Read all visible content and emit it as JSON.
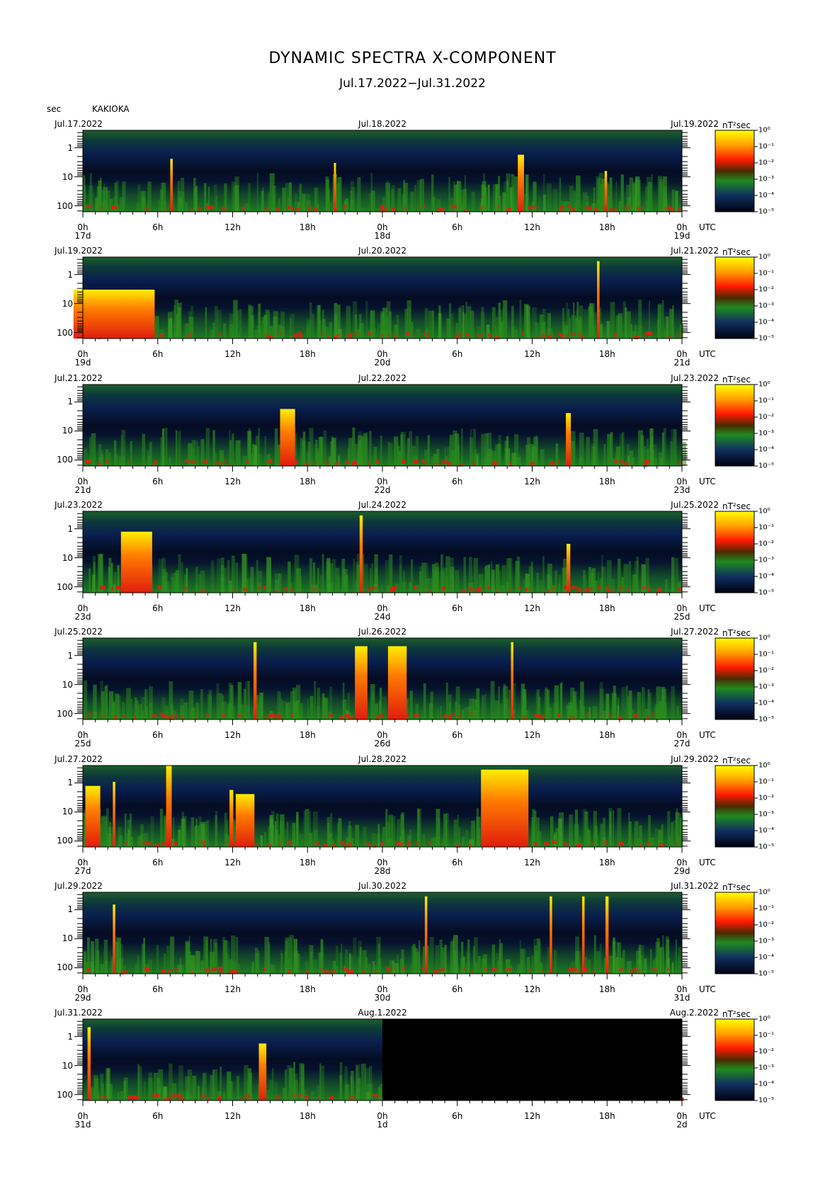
{
  "title": "DYNAMIC SPECTRA X-COMPONENT",
  "subtitle": "Jul.17.2022−Jul.31.2022",
  "y_unit_label": "sec",
  "station": "KAKIOKA",
  "utc_label": "UTC",
  "colorbar_unit": "nT²sec",
  "colors": {
    "background_dark": "#020a1c",
    "navy": "#0b1d52",
    "green": "#1f7a2a",
    "red": "#e01d0e",
    "orange": "#ff7b00",
    "yellow": "#ffee00",
    "no_data": "#000000"
  },
  "chart_data": {
    "type": "heatmap",
    "title": "DYNAMIC SPECTRA X-COMPONENT",
    "subtitle": "Jul.17.2022−Jul.31.2022",
    "ylabel": "sec",
    "y_scale": "log",
    "y_ticks": [
      "1",
      "10",
      "100"
    ],
    "x_ticks": [
      "0h",
      "6h",
      "12h",
      "18h",
      "0h",
      "6h",
      "12h",
      "18h",
      "0h"
    ],
    "colorbar": {
      "unit": "nT²sec",
      "scale": "log",
      "tick_labels": [
        "10⁰",
        "10⁻¹",
        "10⁻²",
        "10⁻³",
        "10⁻⁴",
        "10⁻⁵"
      ]
    },
    "panels": [
      {
        "left_date": "Jul.17.2022",
        "mid_date": "Jul.18.2022",
        "right_date": "Jul.19.2022",
        "day_labels": [
          "17d",
          "18d",
          "19d"
        ],
        "bursts": [
          {
            "t": 7.1,
            "w": 0.2,
            "level": 0.65
          },
          {
            "t": 20.2,
            "w": 0.15,
            "level": 0.6
          },
          {
            "t": 35.1,
            "w": 0.5,
            "level": 0.7
          },
          {
            "t": 41.9,
            "w": 0.2,
            "level": 0.5
          }
        ]
      },
      {
        "left_date": "Jul.19.2022",
        "mid_date": "Jul.20.2022",
        "right_date": "Jul.21.2022",
        "day_labels": [
          "19d",
          "20d",
          "21d"
        ],
        "bursts": [
          {
            "t": 41.3,
            "w": 0.2,
            "level": 0.95
          },
          {
            "t": 2.5,
            "w": 6.5,
            "level": 0.6
          }
        ]
      },
      {
        "left_date": "Jul.21.2022",
        "mid_date": "Jul.22.2022",
        "right_date": "Jul.23.2022",
        "day_labels": [
          "21d",
          "22d",
          "23d"
        ],
        "bursts": [
          {
            "t": 16.4,
            "w": 1.2,
            "level": 0.7
          },
          {
            "t": 38.9,
            "w": 0.4,
            "level": 0.65
          }
        ]
      },
      {
        "left_date": "Jul.23.2022",
        "mid_date": "Jul.24.2022",
        "right_date": "Jul.25.2022",
        "day_labels": [
          "23d",
          "24d",
          "25d"
        ],
        "bursts": [
          {
            "t": 22.3,
            "w": 0.25,
            "level": 0.95
          },
          {
            "t": 4.3,
            "w": 2.5,
            "level": 0.75
          },
          {
            "t": 38.9,
            "w": 0.3,
            "level": 0.6
          }
        ]
      },
      {
        "left_date": "Jul.25.2022",
        "mid_date": "Jul.26.2022",
        "right_date": "Jul.27.2022",
        "day_labels": [
          "25d",
          "26d",
          "27d"
        ],
        "bursts": [
          {
            "t": 13.8,
            "w": 0.25,
            "level": 0.95
          },
          {
            "t": 22.3,
            "w": 1.0,
            "level": 0.9
          },
          {
            "t": 25.2,
            "w": 1.5,
            "level": 0.9
          },
          {
            "t": 34.4,
            "w": 0.2,
            "level": 0.95
          }
        ]
      },
      {
        "left_date": "Jul.27.2022",
        "mid_date": "Jul.28.2022",
        "right_date": "Jul.29.2022",
        "day_labels": [
          "27d",
          "28d",
          "29d"
        ],
        "bursts": [
          {
            "t": 0.8,
            "w": 1.2,
            "level": 0.75
          },
          {
            "t": 2.5,
            "w": 0.2,
            "level": 0.8
          },
          {
            "t": 6.9,
            "w": 0.45,
            "level": 1.0
          },
          {
            "t": 11.9,
            "w": 0.3,
            "level": 0.7
          },
          {
            "t": 13.0,
            "w": 1.5,
            "level": 0.65
          },
          {
            "t": 33.8,
            "w": 3.8,
            "level": 0.95
          }
        ]
      },
      {
        "left_date": "Jul.29.2022",
        "mid_date": "Jul.30.2022",
        "right_date": "Jul.31.2022",
        "day_labels": [
          "29d",
          "30d",
          "31d"
        ],
        "bursts": [
          {
            "t": 2.5,
            "w": 0.2,
            "level": 0.85
          },
          {
            "t": 27.5,
            "w": 0.2,
            "level": 0.95
          },
          {
            "t": 37.5,
            "w": 0.2,
            "level": 0.95
          },
          {
            "t": 40.1,
            "w": 0.2,
            "level": 0.95
          },
          {
            "t": 42.0,
            "w": 0.25,
            "level": 0.95
          }
        ]
      },
      {
        "left_date": "Jul.31.2022",
        "mid_date": "Aug.1.2022",
        "right_date": "Aug.2.2022",
        "day_labels": [
          "31d",
          "1d",
          "2d"
        ],
        "data_end_hours": 24,
        "bursts": [
          {
            "t": 0.5,
            "w": 0.25,
            "level": 0.9
          },
          {
            "t": 14.4,
            "w": 0.6,
            "level": 0.7
          }
        ]
      }
    ]
  }
}
